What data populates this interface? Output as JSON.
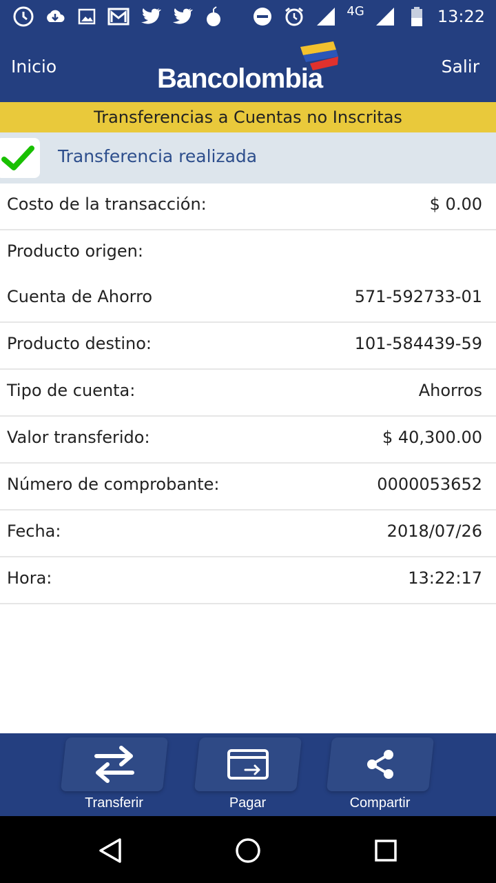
{
  "status_bar": {
    "time": "13:22",
    "network": "4G",
    "icons": [
      "clock-icon",
      "download-cloud-icon",
      "image-icon",
      "gmail-icon",
      "twitter-icon",
      "twitter-icon",
      "bomb-icon",
      "do-not-disturb-icon",
      "alarm-icon",
      "signal-icon",
      "signal-icon",
      "battery-icon"
    ]
  },
  "header": {
    "left_link": "Inicio",
    "brand": "Bancolombia",
    "right_link": "Salir"
  },
  "subtitle": "Transferencias a Cuentas no Inscritas",
  "result": {
    "message": "Transferencia realizada"
  },
  "details": {
    "rows": [
      {
        "label": "Costo de la transacción:",
        "value": "$ 0.00"
      },
      {
        "label": "Producto origen:",
        "value": ""
      },
      {
        "label": "Cuenta de Ahorro",
        "value": "571-592733-01"
      },
      {
        "label": "Producto destino:",
        "value": "101-584439-59"
      },
      {
        "label": "Tipo de cuenta:",
        "value": "Ahorros"
      },
      {
        "label": "Valor transferido:",
        "value": "$ 40,300.00"
      },
      {
        "label": "Número de comprobante:",
        "value": "0000053652"
      },
      {
        "label": "Fecha:",
        "value": "2018/07/26"
      },
      {
        "label": "Hora:",
        "value": "13:22:17"
      }
    ]
  },
  "actions": {
    "transfer": "Transferir",
    "pay": "Pagar",
    "share": "Compartir"
  },
  "colors": {
    "primary": "#243f80",
    "accent_yellow": "#e9c93b",
    "result_bg": "#dde5ec",
    "check_green": "#19c000"
  }
}
